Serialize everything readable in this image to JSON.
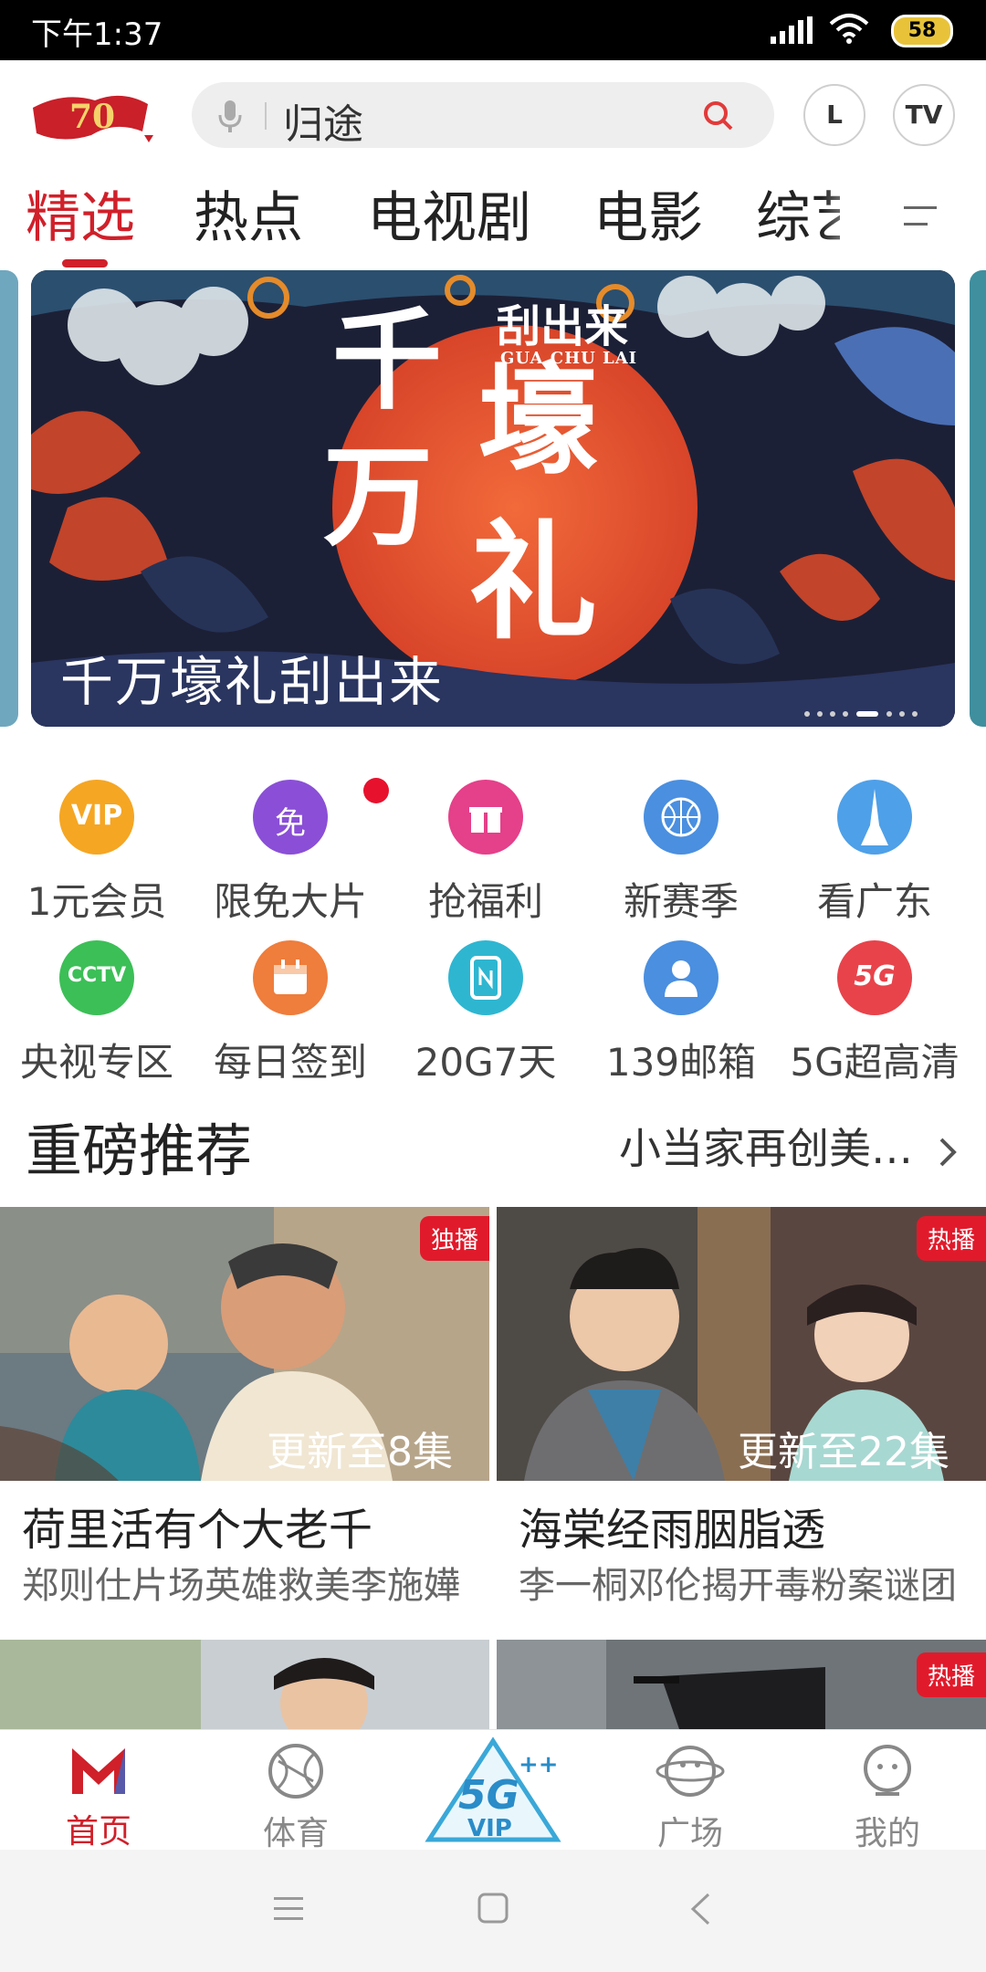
{
  "status_bar": {
    "time": "下午1:37",
    "battery": "58"
  },
  "header": {
    "search": {
      "keyword": "归途"
    },
    "buttons": {
      "l": "L",
      "tv": "TV"
    }
  },
  "tabs": [
    "精选",
    "热点",
    "电视剧",
    "电影",
    "综艺"
  ],
  "banner": {
    "caption": "千万壕礼刮出来",
    "active_dot": 5,
    "dot_count": 8
  },
  "quick_grid": [
    {
      "label": "1元会员",
      "icon": "vip-icon",
      "color": "#f5a623"
    },
    {
      "label": "限免大片",
      "icon": "free-icon",
      "color": "#8a4fd6"
    },
    {
      "label": "抢福利",
      "icon": "gift-icon",
      "color": "#e5408a"
    },
    {
      "label": "新赛季",
      "icon": "basketball-icon",
      "color": "#4a8fe0"
    },
    {
      "label": "看广东",
      "icon": "guangdong-icon",
      "color": "#4ea0e8"
    },
    {
      "label": "央视专区",
      "icon": "cctv-icon",
      "color": "#3cbf57"
    },
    {
      "label": "每日签到",
      "icon": "checkin-icon",
      "color": "#ef7d3c"
    },
    {
      "label": "20G7天",
      "icon": "data-icon",
      "color": "#2eb6d1"
    },
    {
      "label": "139邮箱",
      "icon": "mail-icon",
      "color": "#4a8fe0"
    },
    {
      "label": "5G超高清",
      "icon": "5g-icon",
      "color": "#e8434b"
    }
  ],
  "section": {
    "title": "重磅推荐",
    "more": "小当家再创美…"
  },
  "cards": [
    {
      "tag": "独播",
      "episodes": "更新至8集",
      "title": "荷里活有个大老千",
      "subtitle": "郑则仕片场英雄救美李施嬅"
    },
    {
      "tag": "热播",
      "episodes": "更新至22集",
      "title": "海棠经雨胭脂透",
      "subtitle": "李一桐邓伦揭开毒粉案谜团"
    },
    {
      "tag": "",
      "episodes": "",
      "title": "",
      "subtitle": ""
    },
    {
      "tag": "热播",
      "episodes": "",
      "title": "",
      "subtitle": ""
    }
  ],
  "bottom_nav": [
    {
      "label": "首页",
      "icon": "home-logo-icon",
      "active": true
    },
    {
      "label": "体育",
      "icon": "basketball-icon",
      "active": false
    },
    {
      "label": "",
      "icon": "5g-vip-icon",
      "active": false
    },
    {
      "label": "广场",
      "icon": "planet-icon",
      "active": false
    },
    {
      "label": "我的",
      "icon": "profile-icon",
      "active": false
    }
  ],
  "colors": {
    "accent": "#d0202a",
    "tag": "#e11a2b"
  }
}
